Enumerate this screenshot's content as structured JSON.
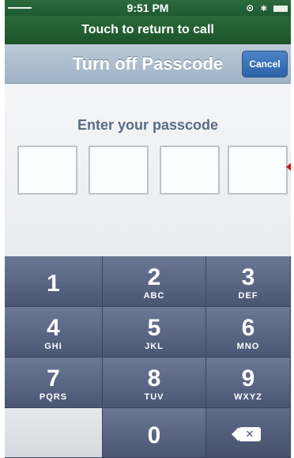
{
  "status_bar": {
    "time": "9:51 PM"
  },
  "call_banner": {
    "text": "Touch to return to call"
  },
  "nav": {
    "title": "Turn off Passcode",
    "cancel_label": "Cancel"
  },
  "passcode": {
    "prompt": "Enter your passcode",
    "digits_entered": 0,
    "box_count": 4
  },
  "keypad": {
    "keys": [
      {
        "digit": "1",
        "letters": ""
      },
      {
        "digit": "2",
        "letters": "ABC"
      },
      {
        "digit": "3",
        "letters": "DEF"
      },
      {
        "digit": "4",
        "letters": "GHI"
      },
      {
        "digit": "5",
        "letters": "JKL"
      },
      {
        "digit": "6",
        "letters": "MNO"
      },
      {
        "digit": "7",
        "letters": "PQRS"
      },
      {
        "digit": "8",
        "letters": "TUV"
      },
      {
        "digit": "9",
        "letters": "WXYZ"
      },
      {
        "digit": "0",
        "letters": ""
      }
    ]
  },
  "colors": {
    "call_banner": "#1f5a30",
    "nav_bar": "#a9bacd",
    "cancel_button": "#2c64a8",
    "keypad": "#5b6783",
    "prompt_text": "#5a6c84"
  },
  "icons": {
    "delete": "delete-backspace-icon",
    "battery": "battery-icon"
  }
}
